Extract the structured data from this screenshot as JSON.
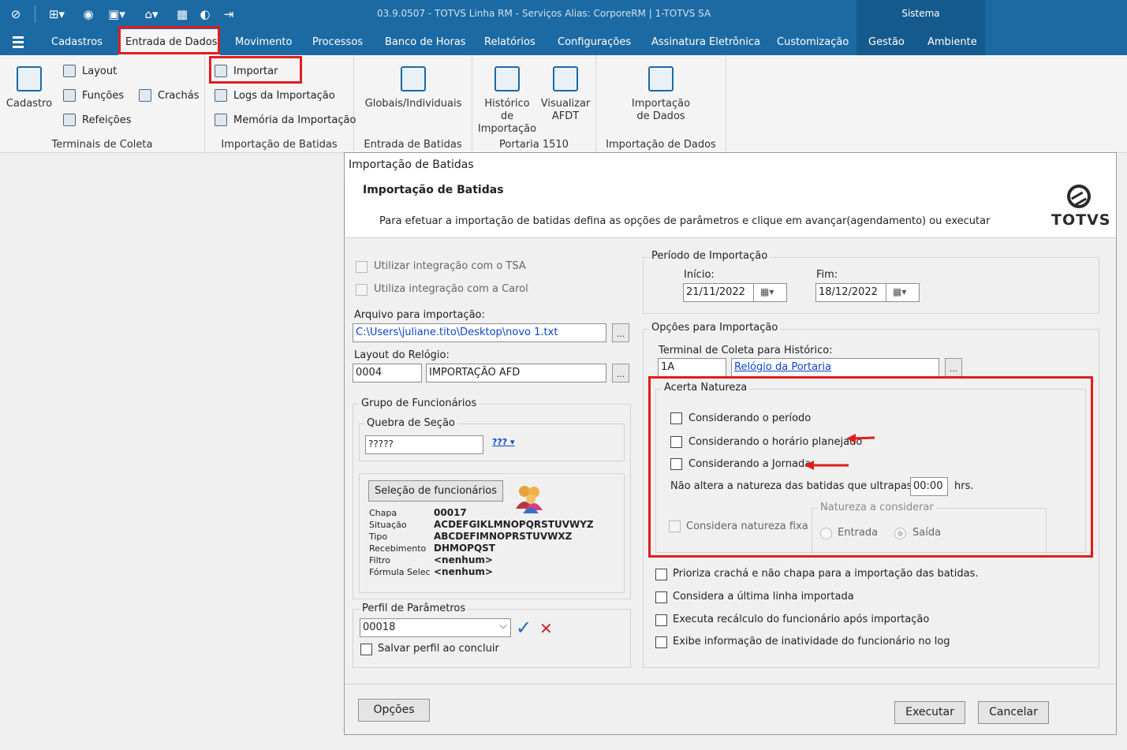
{
  "window": {
    "title": "03.9.0507 - TOTVS Linha RM - Serviços  Alias: CorporeRM | 1-TOTVS SA",
    "context_tab": "Sistema"
  },
  "menu": {
    "items": [
      "Cadastros",
      "Entrada de Dados",
      "Movimento",
      "Processos",
      "Banco de Horas",
      "Relatórios",
      "Configurações",
      "Assinatura Eletrônica",
      "Customização",
      "Gestão",
      "Ambiente"
    ]
  },
  "ribbon": {
    "terminais": {
      "cadastro": "Cadastro",
      "layout": "Layout",
      "funcoes": "Funções",
      "crachas": "Crachás",
      "refeicoes": "Refeições",
      "label": "Terminais de Coleta"
    },
    "importacao_batidas": {
      "importar": "Importar",
      "logs": "Logs da Importação",
      "memoria": "Memória da Importação",
      "label": "Importação de Batidas"
    },
    "entrada_batidas": {
      "globais": "Globais/Individuais",
      "label": "Entrada de Batidas"
    },
    "portaria": {
      "historico_l1": "Histórico de",
      "historico_l2": "Importação",
      "visualizar_l1": "Visualizar",
      "visualizar_l2": "AFDT",
      "label": "Portaria 1510"
    },
    "importacao_dados": {
      "btn_l1": "Importação",
      "btn_l2": "de Dados",
      "label": "Importação de Dados"
    }
  },
  "dialog": {
    "window_title": "Importação de Batidas",
    "heading": "Importação de Batidas",
    "description": "Para efetuar a importação de batidas defina as opções de parâmetros e clique em avançar(agendamento) ou executar",
    "logo_text": "TOTVS",
    "left": {
      "tsa_label": "Utilizar integração com o TSA",
      "carol_label": "Utiliza integração com a Carol",
      "arquivo_label": "Arquivo para importação:",
      "arquivo_value": "C:\\Users\\juliane.tito\\Desktop\\novo 1.txt",
      "layout_label": "Layout do Relógio:",
      "layout_code": "0004",
      "layout_name": "IMPORTAÇÃO AFD",
      "grupo_title": "Grupo de Funcionários",
      "quebra_title": "Quebra de Seção",
      "quebra_value": "?????",
      "quebra_icon_text": "???",
      "selecao_button": "Seleção de funcionários",
      "info": [
        {
          "k": "Chapa",
          "v": "00017"
        },
        {
          "k": "Situação",
          "v": "ACDEFGIKLMNOPQRSTUVWYZ"
        },
        {
          "k": "Tipo",
          "v": "ABCDEFIMNOPRSTUVWXZ"
        },
        {
          "k": "Recebimento",
          "v": "DHMOPQST"
        },
        {
          "k": "Filtro",
          "v": "<nenhum>"
        },
        {
          "k": "Fórmula Selec",
          "v": "<nenhum>"
        }
      ],
      "perfil_title": "Perfil de Parâmetros",
      "perfil_value": "00018",
      "salvar_label": "Salvar perfil ao concluir"
    },
    "right": {
      "periodo_title": "Período de Importação",
      "inicio_label": "Início:",
      "inicio_value": "21/11/2022",
      "fim_label": "Fim:",
      "fim_value": "18/12/2022",
      "opcoes_title": "Opções para Importação",
      "terminal_label": "Terminal de Coleta para Histórico:",
      "terminal_code": "1A",
      "terminal_name": "Relógio da Portaria",
      "acerta_title": "Acerta Natureza",
      "considerando_periodo": "Considerando o período",
      "considerando_horario": "Considerando o horário planejado",
      "considerando_jornada": "Considerando a Jornada",
      "nao_altera_label": "Não altera a natureza das batidas que ultrapassem",
      "nao_altera_value": "00:00",
      "hrs_label": "hrs.",
      "natureza_title": "Natureza a considerar",
      "natureza_fixa": "Considera natureza fixa",
      "entrada": "Entrada",
      "saida": "Saída",
      "prioriza": "Prioriza crachá e não chapa para a importação das batidas.",
      "ultima_linha": "Considera a última linha importada",
      "recalculo": "Executa recálculo do funcionário após importação",
      "inatividade": "Exibe informação de inatividade do funcionário no log"
    },
    "buttons": {
      "opcoes": "Opções",
      "executar": "Executar",
      "cancelar": "Cancelar"
    }
  }
}
